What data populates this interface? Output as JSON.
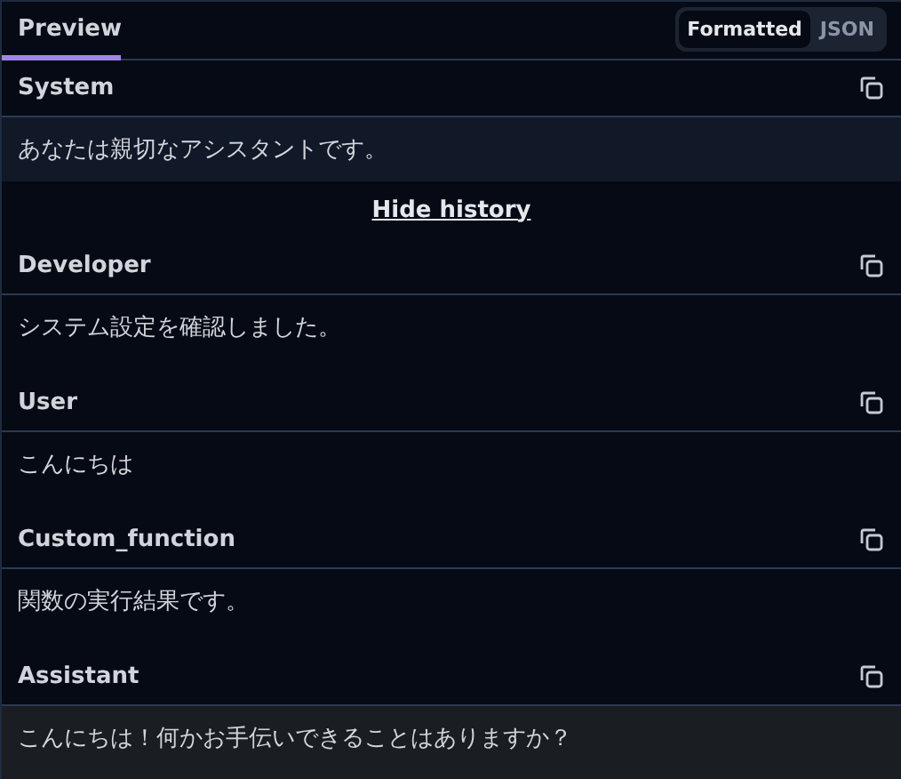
{
  "tabs": [
    {
      "label": "Preview",
      "selected": true
    }
  ],
  "view_toggle": [
    {
      "label": "Formatted",
      "selected": true
    },
    {
      "label": "JSON",
      "selected": false
    }
  ],
  "messages": [
    {
      "role": "System",
      "text": "あなたは親切なアシスタントです。",
      "kind": "system"
    }
  ],
  "history_toggle": "Hide history",
  "history": [
    {
      "role": "Developer",
      "text": "システム設定を確認しました。",
      "kind": "history"
    },
    {
      "role": "User",
      "text": "こんにちは",
      "kind": "history"
    },
    {
      "role": "Custom_function",
      "text": "関数の実行結果です。",
      "kind": "history"
    },
    {
      "role": "Assistant",
      "text": "こんにちは！何かお手伝いできることはありますか？",
      "kind": "latest"
    }
  ]
}
